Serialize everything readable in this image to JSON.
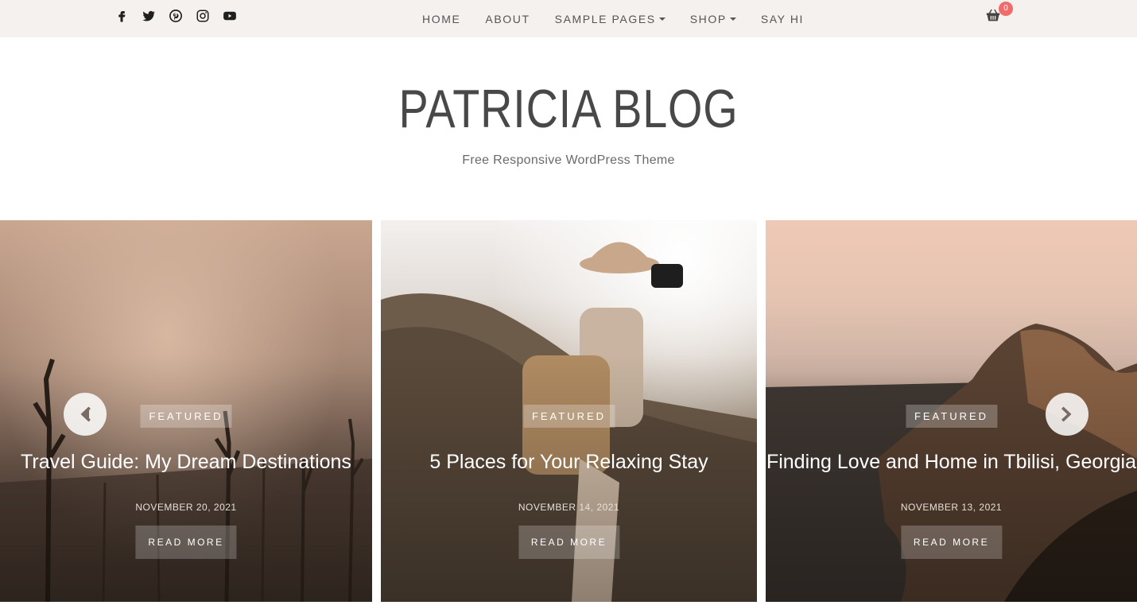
{
  "social": [
    "facebook-icon",
    "twitter-icon",
    "pinterest-icon",
    "instagram-icon",
    "youtube-icon"
  ],
  "nav": {
    "items": [
      {
        "label": "HOME",
        "dropdown": false
      },
      {
        "label": "ABOUT",
        "dropdown": false
      },
      {
        "label": "SAMPLE PAGES",
        "dropdown": true
      },
      {
        "label": "SHOP",
        "dropdown": true
      },
      {
        "label": "SAY HI",
        "dropdown": false
      }
    ]
  },
  "cart": {
    "icon": "basket-icon",
    "count": "0",
    "badge_color": "#f16b6b"
  },
  "brand": {
    "title": "PATRICIA BLOG",
    "tagline": "Free Responsive WordPress Theme"
  },
  "slides": [
    {
      "label": "FEATURED",
      "title": "Travel Guide: My Dream Destinations",
      "date": "NOVEMBER 20, 2021",
      "button": "READ MORE"
    },
    {
      "label": "FEATURED",
      "title": "5 Places for Your Relaxing Stay",
      "date": "NOVEMBER 14, 2021",
      "button": "READ MORE"
    },
    {
      "label": "FEATURED",
      "title": "Finding Love and Home in Tbilisi, Georgia",
      "date": "NOVEMBER 13, 2021",
      "button": "READ MORE"
    }
  ],
  "slider": {
    "prev_icon": "chevron-left-icon",
    "next_icon": "chevron-right-icon"
  },
  "colors": {
    "topbar_bg": "#f5f1ee",
    "title": "#484848",
    "nav_text": "#555555"
  }
}
